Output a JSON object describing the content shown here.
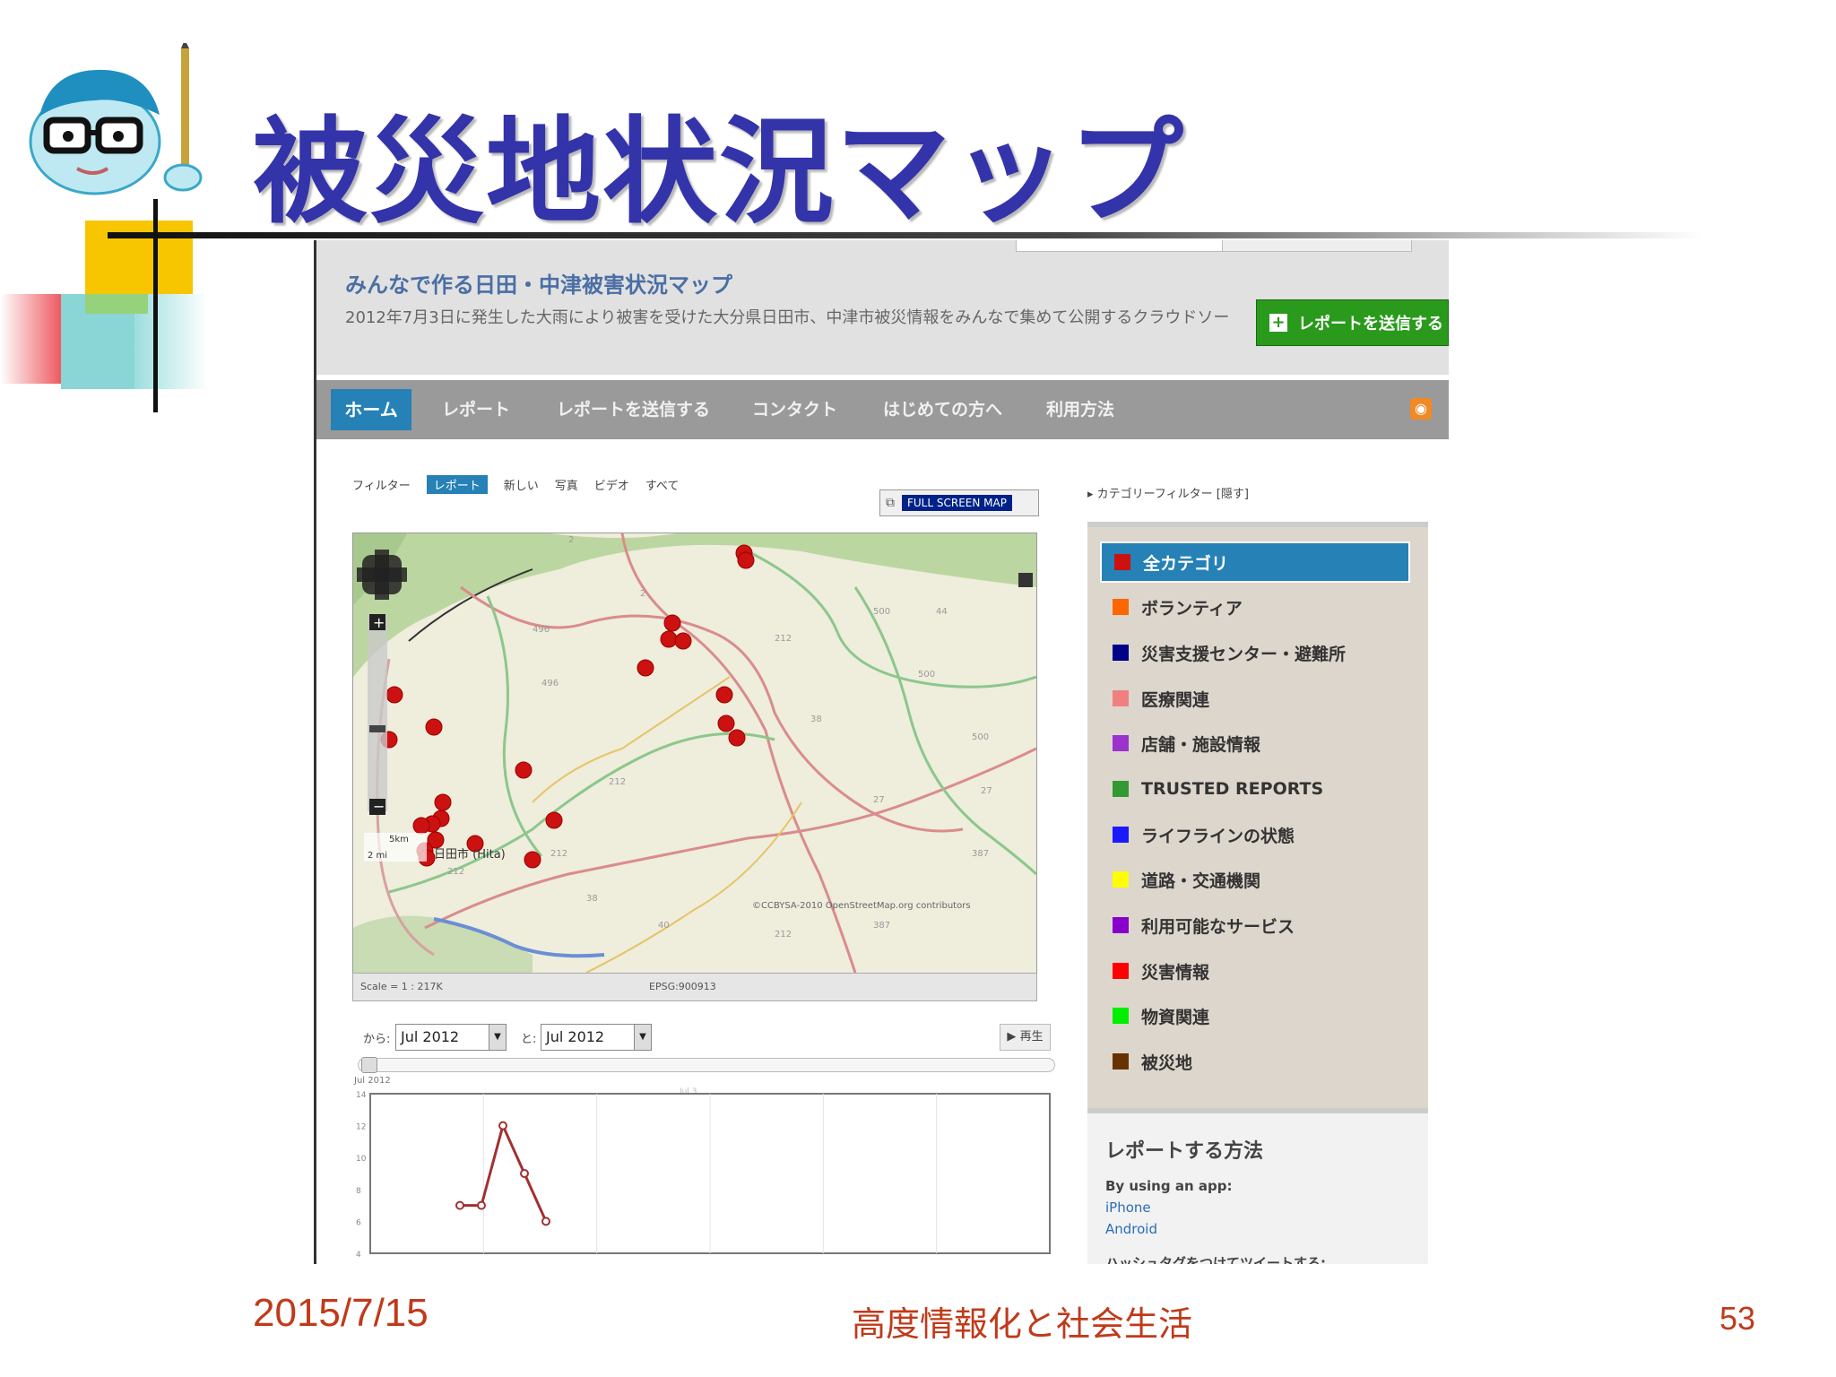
{
  "slide": {
    "title": "被災地状況マップ",
    "footer_date": "2015/7/15",
    "footer_center": "高度情報化と社会生活",
    "page_number": "53"
  },
  "site": {
    "title": "みんなで作る日田・中津被害状況マップ",
    "description": "2012年7月3日に発生した大雨により被害を受けた大分県日田市、中津市被災情報をみんなで集めて公開するクラウドソー",
    "submit_button": "レポートを送信する"
  },
  "nav": {
    "items": [
      "ホーム",
      "レポート",
      "レポートを送信する",
      "コンタクト",
      "はじめての方へ",
      "利用方法"
    ]
  },
  "filters": {
    "label": "フィルター",
    "items": [
      "レポート",
      "新しい",
      "写真",
      "ビデオ",
      "すべて"
    ],
    "active_index": 0
  },
  "map": {
    "fullscreen_label": "FULL SCREEN MAP",
    "scale_text": "Scale = 1 : 217K",
    "projection": "EPSG:900913",
    "attribution": "©CCBYSA-2010 OpenStreetMap.org contributors",
    "scale_km": "5km",
    "scale_mi": "2 mi",
    "town_label": "日田市 (Hita)",
    "road_labels": [
      "2",
      "2",
      "500",
      "44",
      "212",
      "496",
      "496",
      "500",
      "38",
      "500",
      "212",
      "27",
      "27",
      "387",
      "212",
      "212",
      "38",
      "40",
      "387",
      "212"
    ],
    "marker_color": "#cc1111"
  },
  "timeline": {
    "from_label": "から:",
    "from_value": "Jul 2012",
    "to_label": "と:",
    "to_value": "Jul 2012",
    "play_label": "再生",
    "x_start_label": "Jul 2012",
    "x_mid_label": "Jul 3",
    "y_ticks": [
      14,
      12,
      10,
      8,
      6,
      4
    ]
  },
  "chart_data": {
    "type": "line",
    "x": [
      1,
      2,
      3,
      4,
      5
    ],
    "values": [
      7,
      7,
      12,
      9,
      6
    ],
    "ylim": [
      4,
      14
    ],
    "color": "#a23030"
  },
  "categories": {
    "filter_label": "カテゴリーフィルター",
    "filter_toggle": "[隠す]",
    "items": [
      {
        "label": "全カテゴリ",
        "color": "#cc1111"
      },
      {
        "label": "ボランティア",
        "color": "#ff6600"
      },
      {
        "label": "災害支援センター・避難所",
        "color": "#000088"
      },
      {
        "label": "医療関連",
        "color": "#f08080"
      },
      {
        "label": "店舗・施設情報",
        "color": "#9933cc"
      },
      {
        "label": "TRUSTED REPORTS",
        "color": "#339933"
      },
      {
        "label": "ライフラインの状態",
        "color": "#1a1aff"
      },
      {
        "label": "道路・交通機関",
        "color": "#ffff00"
      },
      {
        "label": "利用可能なサービス",
        "color": "#8800cc"
      },
      {
        "label": "災害情報",
        "color": "#ff0000"
      },
      {
        "label": "物資関連",
        "color": "#00ee00"
      },
      {
        "label": "被災地",
        "color": "#663300"
      }
    ]
  },
  "how_to": {
    "title": "レポートする方法",
    "app_label": "By using an app:",
    "app_links": [
      "iPhone",
      "Android"
    ],
    "hashtag_label": "ハッシュタグをつけてツイートする:"
  }
}
